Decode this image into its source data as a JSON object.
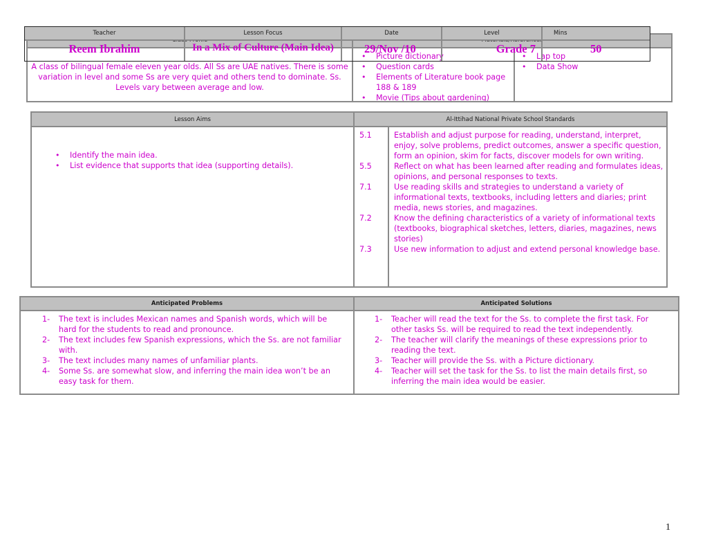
{
  "header": {
    "columns": [
      {
        "label": "Teacher",
        "value": "Reem Ibrahim"
      },
      {
        "label": "Lesson Focus",
        "value": "In a Mix of Culture (Main Idea)"
      },
      {
        "label": "Date",
        "value": "29/Nov /10"
      },
      {
        "label": "Level",
        "value": "Grade 7"
      },
      {
        "label": "Mins",
        "value": "50"
      }
    ]
  },
  "profile": {
    "class_profile_label": "Class Profile",
    "materials_label": "Materials/References",
    "class_profile_text": "A class of bilingual female eleven year olds. All Ss are UAE natives. There is some variation in level and some Ss are very quiet and others tend to dominate. Ss. Levels vary between average and low.",
    "materials_col1": [
      "Picture dictionary",
      "Question cards",
      "Elements of Literature book page 188 & 189",
      "Movie (Tips about gardening)"
    ],
    "materials_col2": [
      "Lap top",
      "Data Show"
    ]
  },
  "aims": {
    "label": "Lesson Aims",
    "items": [
      "Identify the main idea.",
      "List evidence that supports that idea (supporting details)."
    ]
  },
  "standards": {
    "label": "Al-Ittihad National Private School Standards",
    "items": [
      {
        "code": "5.1",
        "text": "Establish and adjust purpose for reading, understand, interpret, enjoy, solve problems, predict outcomes, answer a specific question, form an opinion, skim for facts, discover models for own writing."
      },
      {
        "code": "5.5",
        "text": "Reflect on what has been learned after reading and formulates ideas, opinions, and personal responses to texts."
      },
      {
        "code": "7.1",
        "text": "Use reading skills and strategies to understand a variety of informational texts, textbooks, including letters and diaries; print media, news stories, and magazines."
      },
      {
        "code": "7.2",
        "text": "Know the defining characteristics of a variety of informational texts (textbooks, biographical sketches, letters, diaries, magazines, news stories)"
      },
      {
        "code": "7.3",
        "text": "Use new information to adjust and extend personal knowledge base."
      }
    ]
  },
  "problems": {
    "label": "Anticipated Problems",
    "items": [
      {
        "num": "1-",
        "text": "The text is includes Mexican names and Spanish words, which will be hard for the students to read and pronounce."
      },
      {
        "num": "2-",
        "text": "The text includes few Spanish expressions, which the Ss. are not familiar with."
      },
      {
        "num": "3-",
        "text": "The text includes many names of unfamiliar plants."
      },
      {
        "num": "4-",
        "text": "Some Ss. are somewhat slow, and inferring the main idea won’t be an easy task for them."
      }
    ]
  },
  "solutions": {
    "label": "Anticipated Solutions",
    "items": [
      {
        "num": "1-",
        "text": "Teacher will read the text for the Ss. to complete the first task. For other tasks Ss. will be required to read the text independently."
      },
      {
        "num": "2-",
        "text": "The teacher will clarify the meanings of these expressions prior to reading the text."
      },
      {
        "num": "3-",
        "text": "Teacher will provide the Ss. with a Picture dictionary."
      },
      {
        "num": "4-",
        "text": "Teacher will set the task for the Ss. to list the main details first, so inferring the main idea would be easier."
      }
    ]
  },
  "page_number": "1"
}
